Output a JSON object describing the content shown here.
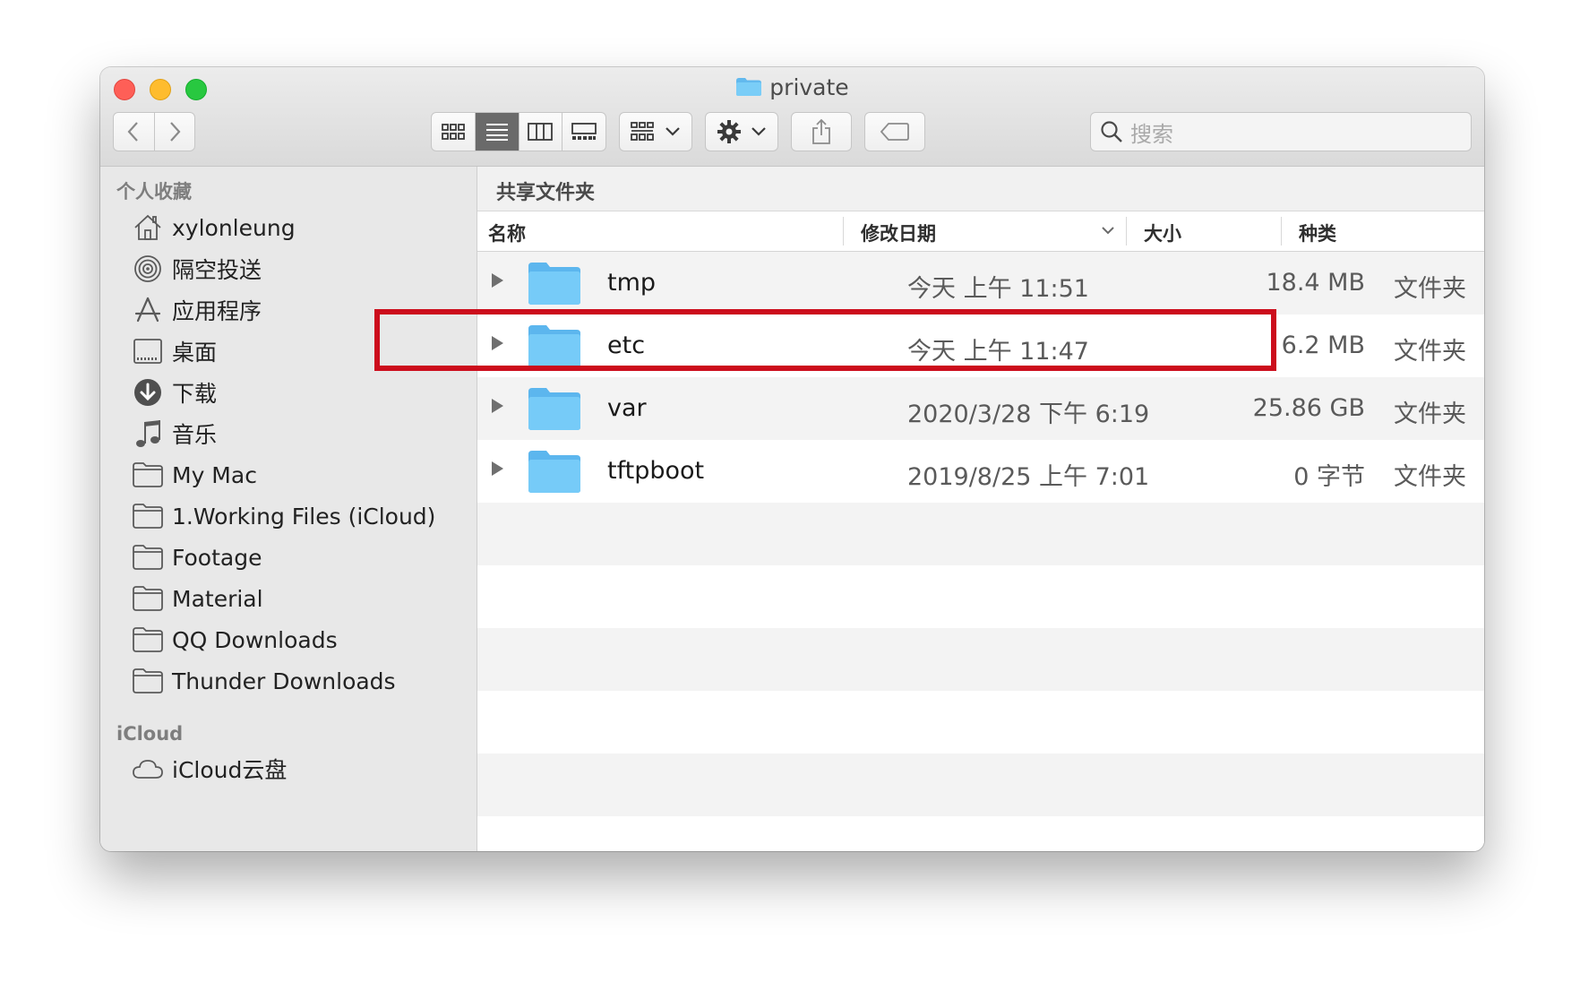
{
  "window": {
    "title": "private"
  },
  "search": {
    "placeholder": "搜索"
  },
  "sidebar": {
    "favorites_header": "个人收藏",
    "favorites": [
      {
        "label": "xylonleung",
        "icon": "home-icon"
      },
      {
        "label": "隔空投送",
        "icon": "airdrop-icon"
      },
      {
        "label": "应用程序",
        "icon": "applications-icon"
      },
      {
        "label": "桌面",
        "icon": "desktop-icon"
      },
      {
        "label": "下载",
        "icon": "download-icon"
      },
      {
        "label": "音乐",
        "icon": "music-icon"
      },
      {
        "label": "My Mac",
        "icon": "folder-icon"
      },
      {
        "label": "1.Working Files (iCloud)",
        "icon": "folder-icon"
      },
      {
        "label": "Footage",
        "icon": "folder-icon"
      },
      {
        "label": "Material",
        "icon": "folder-icon"
      },
      {
        "label": "QQ Downloads",
        "icon": "folder-icon"
      },
      {
        "label": "Thunder Downloads",
        "icon": "folder-icon"
      }
    ],
    "icloud_header": "iCloud",
    "icloud": [
      {
        "label": "iCloud云盘",
        "icon": "cloud-icon"
      }
    ]
  },
  "pathbar": {
    "label": "共享文件夹"
  },
  "columns": {
    "name": "名称",
    "date": "修改日期",
    "size": "大小",
    "kind": "种类"
  },
  "files": [
    {
      "name": "tmp",
      "date": "今天 上午 11:51",
      "size": "18.4 MB",
      "kind": "文件夹"
    },
    {
      "name": "etc",
      "date": "今天 上午 11:47",
      "size": "6.2 MB",
      "kind": "文件夹"
    },
    {
      "name": "var",
      "date": "2020/3/28 下午 6:19",
      "size": "25.86 GB",
      "kind": "文件夹"
    },
    {
      "name": "tftpboot",
      "date": "2019/8/25 上午 7:01",
      "size": "0 字节",
      "kind": "文件夹"
    }
  ],
  "colors": {
    "highlight": "#cc0d1c",
    "folder": "#6cc4f5"
  }
}
